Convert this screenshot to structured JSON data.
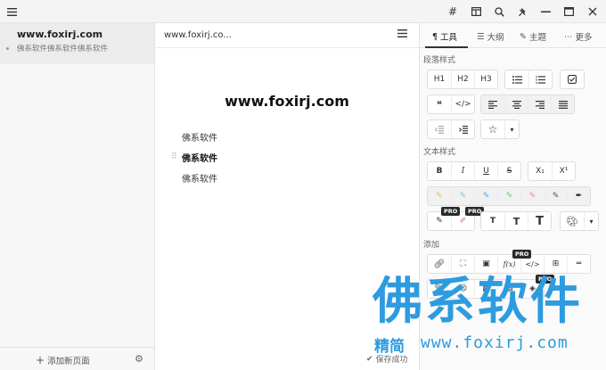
{
  "titlebar": {
    "menu_icon": "hamburger-icon",
    "icons": [
      "hash-icon",
      "layout-icon",
      "search-icon",
      "pin-icon",
      "minimize-icon",
      "maximize-icon",
      "close-icon"
    ]
  },
  "sidebar": {
    "pages": [
      {
        "title": "www.foxirj.com",
        "excerpt": "佛系软件佛系软件佛系软件"
      }
    ],
    "add_page_label": "添加新页面",
    "settings_icon": "gear-icon"
  },
  "editor": {
    "header_title": "www.foxirj.co...",
    "heading": "www.foxirj.com",
    "lines": [
      "佛系软件",
      "佛系软件",
      "佛系软件"
    ],
    "save_status": "保存成功"
  },
  "panel": {
    "tabs": [
      {
        "label": "工具",
        "glyph": "¶"
      },
      {
        "label": "大纲",
        "glyph": "☰"
      },
      {
        "label": "主题",
        "glyph": "✎"
      },
      {
        "label": "更多",
        "glyph": "⋯"
      }
    ],
    "sections": {
      "paragraph": "段落样式",
      "text": "文本样式",
      "add": "添加"
    },
    "headings": [
      "H1",
      "H2",
      "H3"
    ],
    "format": {
      "bold": "B",
      "italic": "I",
      "underline": "U",
      "strike": "S",
      "subscript": "X₁",
      "superscript": "X¹"
    },
    "text_sizes": [
      "T",
      "T",
      "T"
    ],
    "pro_label": "PRO"
  },
  "watermark": {
    "big": "佛系软件",
    "small": "精简",
    "url": "www.foxirj.com"
  },
  "colors": {
    "accent": "#2d9be0",
    "highlight_yellow": "#f6e27a",
    "highlight_blue": "#9fd0f0",
    "highlight_green": "#a8dca8",
    "highlight_pink": "#f3a9c1"
  }
}
